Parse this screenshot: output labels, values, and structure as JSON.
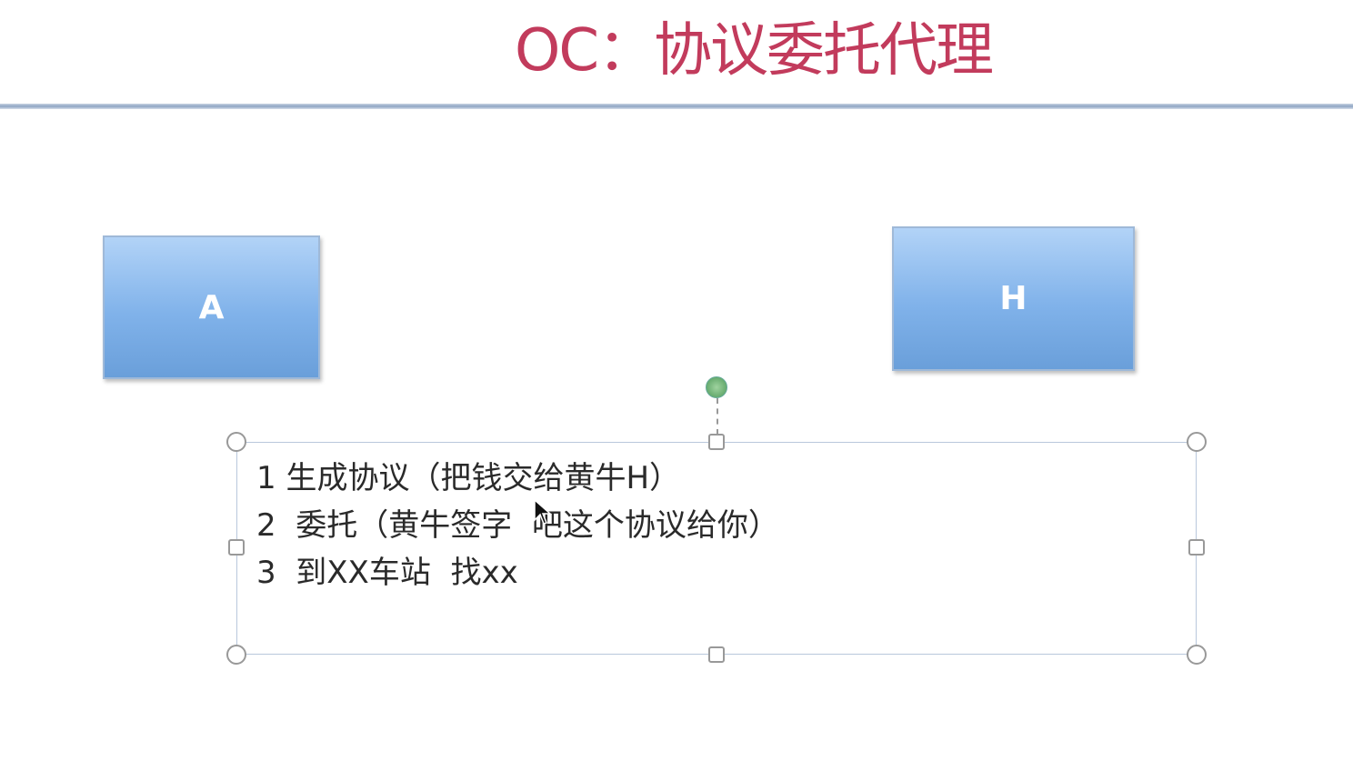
{
  "slide": {
    "title": "OC：协议委托代理",
    "box_a_label": "A",
    "box_h_label": "H",
    "text_lines": [
      "1 生成协议（把钱交给黄牛H）",
      "2  委托（黄牛签字  吧这个协议给你）",
      "3  到XX车站  找xx"
    ]
  },
  "colors": {
    "title": "#c23b5c",
    "box_fill": "#80b2ea",
    "selection_border": "#b9c8dc"
  }
}
